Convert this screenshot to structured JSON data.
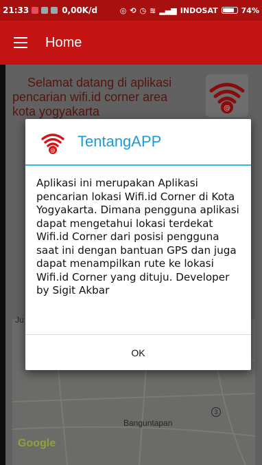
{
  "status_bar": {
    "time": "21:33",
    "speed": "0,00K/d",
    "carrier": "INDOSAT",
    "battery": "74%"
  },
  "app_bar": {
    "title": "Home"
  },
  "background": {
    "welcome_lines": [
      "Selamat datang di aplikasi",
      "pencarian wifi.id corner area",
      "kota yogyakarta"
    ],
    "map_place_label": "Banguntapan",
    "map_left_letter": "Ju",
    "map_route_badge": "3",
    "google_logo": "Google"
  },
  "dialog": {
    "title": "TentangAPP",
    "message": "Aplikasi ini merupakan Aplikasi pencarian lokasi Wifi.id Corner di Kota Yogyakarta. Dimana pengguna aplikasi dapat mengetahui lokasi terdekat Wifi.id Corner dari posisi pengguna saat ini dengan bantuan GPS dan juga dapat menampilkan rute ke lokasi Wifi.id Corner yang dituju. Developer by Sigit Akbar",
    "ok_label": "OK"
  },
  "colors": {
    "primary": "#c41313",
    "status_bar": "#a81010",
    "dialog_accent": "#33b5e5",
    "dialog_title": "#1e9ad6"
  },
  "icons": {
    "menu": "hamburger-menu-icon",
    "app_logo": "wifi-logo-icon"
  }
}
